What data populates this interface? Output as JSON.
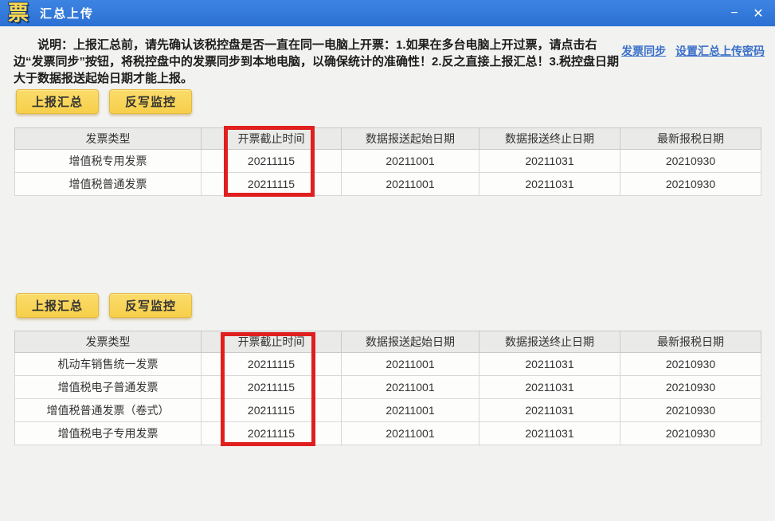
{
  "titlebar": {
    "logo": "票",
    "title": "汇总上传",
    "minimize_glyph": "−",
    "close_glyph": "✕"
  },
  "header": {
    "description": "说明：上报汇总前，请先确认该税控盘是否一直在同一电脑上开票：1.如果在多台电脑上开过票，请点击右边“发票同步”按钮，将税控盘中的发票同步到本地电脑，以确保统计的准确性！2.反之直接上报汇总！3.税控盘日期大于数据报送起始日期才能上报。",
    "links": [
      {
        "label": "发票同步"
      },
      {
        "label": "设置汇总上传密码"
      }
    ]
  },
  "buttons": {
    "report_summary": "上报汇总",
    "writeback_monitor": "反写监控"
  },
  "tables": [
    {
      "headers": [
        "发票类型",
        "开票截止时间",
        "数据报送起始日期",
        "数据报送终止日期",
        "最新报税日期"
      ],
      "rows": [
        [
          "增值税专用发票",
          "20211115",
          "20211001",
          "20211031",
          "20210930"
        ],
        [
          "增值税普通发票",
          "20211115",
          "20211001",
          "20211031",
          "20210930"
        ]
      ]
    },
    {
      "headers": [
        "发票类型",
        "开票截止时间",
        "数据报送起始日期",
        "数据报送终止日期",
        "最新报税日期"
      ],
      "rows": [
        [
          "机动车销售统一发票",
          "20211115",
          "20211001",
          "20211031",
          "20210930"
        ],
        [
          "增值税电子普通发票",
          "20211115",
          "20211001",
          "20211031",
          "20210930"
        ],
        [
          "增值税普通发票（卷式）",
          "20211115",
          "20211001",
          "20211031",
          "20210930"
        ],
        [
          "增值税电子专用发票",
          "20211115",
          "20211001",
          "20211031",
          "20210930"
        ]
      ]
    }
  ],
  "colors": {
    "titlebar_blue": "#2e76d8",
    "button_yellow": "#f8d75c",
    "highlight_red": "#e01f1f",
    "link_blue": "#3a6fc8",
    "logo_gold": "#ffd84d",
    "body_gray": "#f2f2f0"
  }
}
